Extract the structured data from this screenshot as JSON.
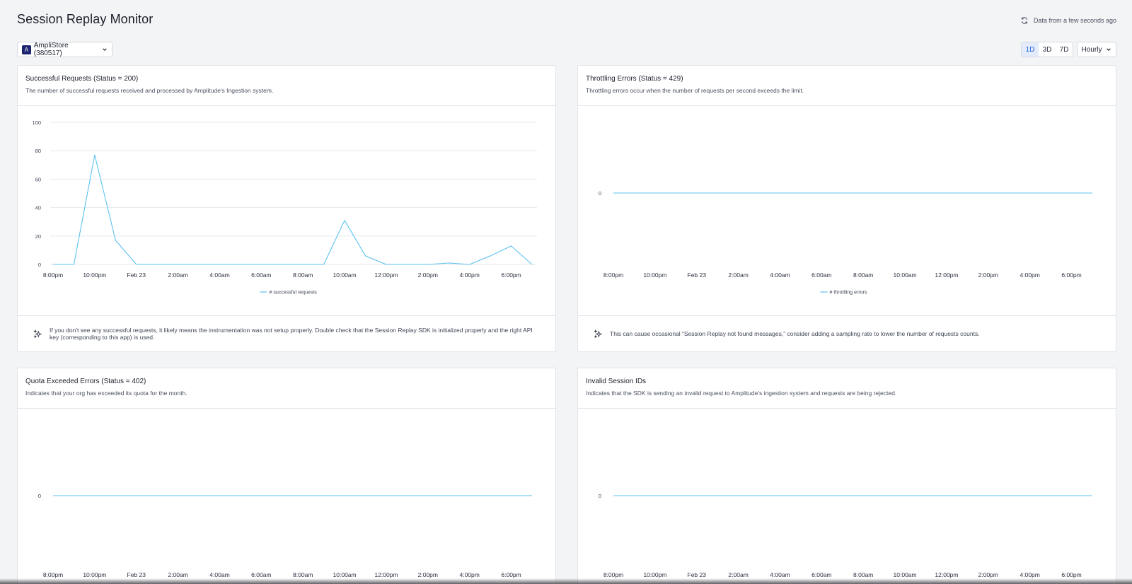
{
  "header": {
    "title": "Session Replay Monitor",
    "freshness": "Data from a few seconds ago",
    "icon_refresh": "refresh-icon"
  },
  "filters": {
    "app_badge": "A",
    "app_label": "AmpliStore (380517)",
    "ranges": [
      "1D",
      "3D",
      "7D"
    ],
    "active_range": "1D",
    "interval": "Hourly"
  },
  "x_ticks": [
    "8:00pm",
    "10:00pm",
    "Feb 23",
    "2:00am",
    "4:00am",
    "6:00am",
    "8:00am",
    "10:00am",
    "12:00pm",
    "2:00pm",
    "4:00pm",
    "6:00pm"
  ],
  "cards": [
    {
      "title": "Successful Requests (Status = 200)",
      "description": "The number of successful requests received and processed by Amplitude's Ingestion system.",
      "tip": "If you don't see any successful requests, it likely means the instrumentation was not setup properly. Double check that the Session Replay SDK is initialized properly and the right API key (corresponding to this app) is used."
    },
    {
      "title": "Throttling Errors (Status = 429)",
      "description": "Throttling errors occur when the number of requests per second exceeds the limit.",
      "tip": "This can cause occasional “Session Replay not found messages,” consider adding a sampling rate to lower the number of requests counts."
    },
    {
      "title": "Quota Exceeded Errors (Status = 402)",
      "description": "Indicates that your org has exceeded its quota for the month."
    },
    {
      "title": "Invalid Session IDs",
      "description": "Indicates that the SDK is sending an invalid request to Amplitude's ingestion system and requests are being rejected."
    }
  ],
  "chart_data": [
    {
      "type": "line",
      "x": [
        "8:00pm",
        "9:00pm",
        "10:00pm",
        "11:00pm",
        "Feb 23",
        "1:00am",
        "2:00am",
        "3:00am",
        "4:00am",
        "5:00am",
        "6:00am",
        "7:00am",
        "8:00am",
        "9:00am",
        "10:00am",
        "11:00am",
        "12:00pm",
        "1:00pm",
        "2:00pm",
        "3:00pm",
        "4:00pm",
        "5:00pm",
        "6:00pm",
        "7:00pm"
      ],
      "series": [
        {
          "name": "# successful requests",
          "values": [
            0,
            0,
            77,
            17,
            0,
            0,
            0,
            0,
            0,
            0,
            0,
            0,
            0,
            0,
            31,
            6,
            0,
            0,
            0,
            1,
            0,
            6,
            13,
            0
          ]
        }
      ],
      "yticks": [
        0,
        20,
        40,
        60,
        80,
        100
      ],
      "ylim": [
        0,
        100
      ],
      "grid": true,
      "legend": "bottom",
      "color": "#5cc2ef"
    },
    {
      "type": "line",
      "x": [
        "8:00pm",
        "9:00pm",
        "10:00pm",
        "11:00pm",
        "Feb 23",
        "1:00am",
        "2:00am",
        "3:00am",
        "4:00am",
        "5:00am",
        "6:00am",
        "7:00am",
        "8:00am",
        "9:00am",
        "10:00am",
        "11:00am",
        "12:00pm",
        "1:00pm",
        "2:00pm",
        "3:00pm",
        "4:00pm",
        "5:00pm",
        "6:00pm",
        "7:00pm"
      ],
      "series": [
        {
          "name": "# throttling errors",
          "values": [
            0,
            0,
            0,
            0,
            0,
            0,
            0,
            0,
            0,
            0,
            0,
            0,
            0,
            0,
            0,
            0,
            0,
            0,
            0,
            0,
            0,
            0,
            0,
            0
          ]
        }
      ],
      "yticks": [
        0
      ],
      "legend": "bottom",
      "color": "#5cc2ef"
    },
    {
      "type": "line",
      "x": [
        "8:00pm",
        "9:00pm",
        "10:00pm",
        "11:00pm",
        "Feb 23",
        "1:00am",
        "2:00am",
        "3:00am",
        "4:00am",
        "5:00am",
        "6:00am",
        "7:00am",
        "8:00am",
        "9:00am",
        "10:00am",
        "11:00am",
        "12:00pm",
        "1:00pm",
        "2:00pm",
        "3:00pm",
        "4:00pm",
        "5:00pm",
        "6:00pm",
        "7:00pm"
      ],
      "series": [
        {
          "values": [
            0,
            0,
            0,
            0,
            0,
            0,
            0,
            0,
            0,
            0,
            0,
            0,
            0,
            0,
            0,
            0,
            0,
            0,
            0,
            0,
            0,
            0,
            0,
            0
          ]
        }
      ],
      "yticks": [
        0
      ],
      "color": "#5cc2ef"
    },
    {
      "type": "line",
      "x": [
        "8:00pm",
        "9:00pm",
        "10:00pm",
        "11:00pm",
        "Feb 23",
        "1:00am",
        "2:00am",
        "3:00am",
        "4:00am",
        "5:00am",
        "6:00am",
        "7:00am",
        "8:00am",
        "9:00am",
        "10:00am",
        "11:00am",
        "12:00pm",
        "1:00pm",
        "2:00pm",
        "3:00pm",
        "4:00pm",
        "5:00pm",
        "6:00pm",
        "7:00pm"
      ],
      "series": [
        {
          "values": [
            0,
            0,
            0,
            0,
            0,
            0,
            0,
            0,
            0,
            0,
            0,
            0,
            0,
            0,
            0,
            0,
            0,
            0,
            0,
            0,
            0,
            0,
            0,
            0
          ]
        }
      ],
      "yticks": [
        0
      ],
      "color": "#5cc2ef"
    }
  ]
}
